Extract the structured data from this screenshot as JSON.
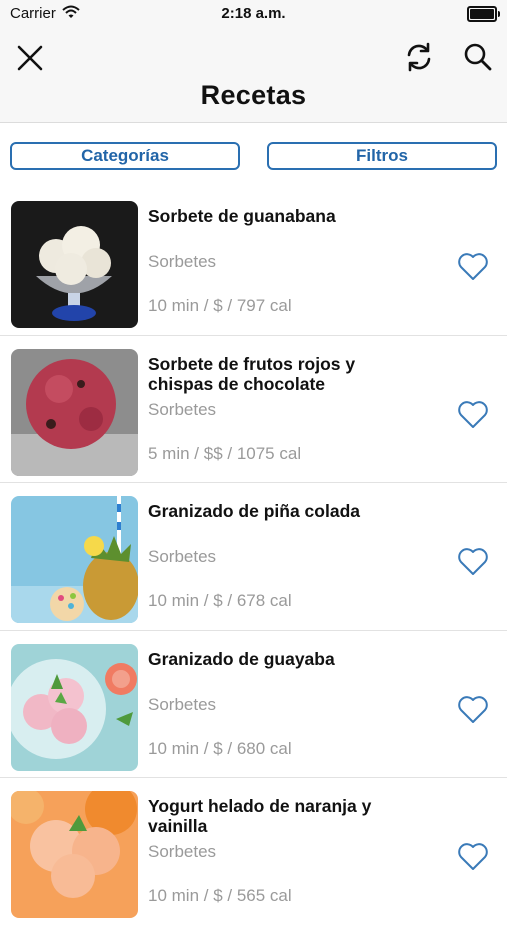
{
  "status": {
    "carrier": "Carrier",
    "time": "2:18 a.m."
  },
  "nav": {
    "title": "Recetas"
  },
  "buttons": {
    "categories": "Categorías",
    "filters": "Filtros"
  },
  "recipes": [
    {
      "title": "Sorbete de guanabana",
      "category": "Sorbetes",
      "meta": "10 min / $ / 797 cal"
    },
    {
      "title": "Sorbete de frutos rojos y chispas de chocolate",
      "category": "Sorbetes",
      "meta": "5 min / $$ / 1075 cal"
    },
    {
      "title": "Granizado de piña colada",
      "category": "Sorbetes",
      "meta": "10 min / $ / 678 cal"
    },
    {
      "title": "Granizado de guayaba",
      "category": "Sorbetes",
      "meta": "10 min / $ / 680 cal"
    },
    {
      "title": "Yogurt helado de naranja y vainilla",
      "category": "Sorbetes",
      "meta": "10 min / $ / 565 cal"
    }
  ],
  "colors": {
    "accent": "#2a6fb1",
    "heart": "#3a7ab8"
  }
}
